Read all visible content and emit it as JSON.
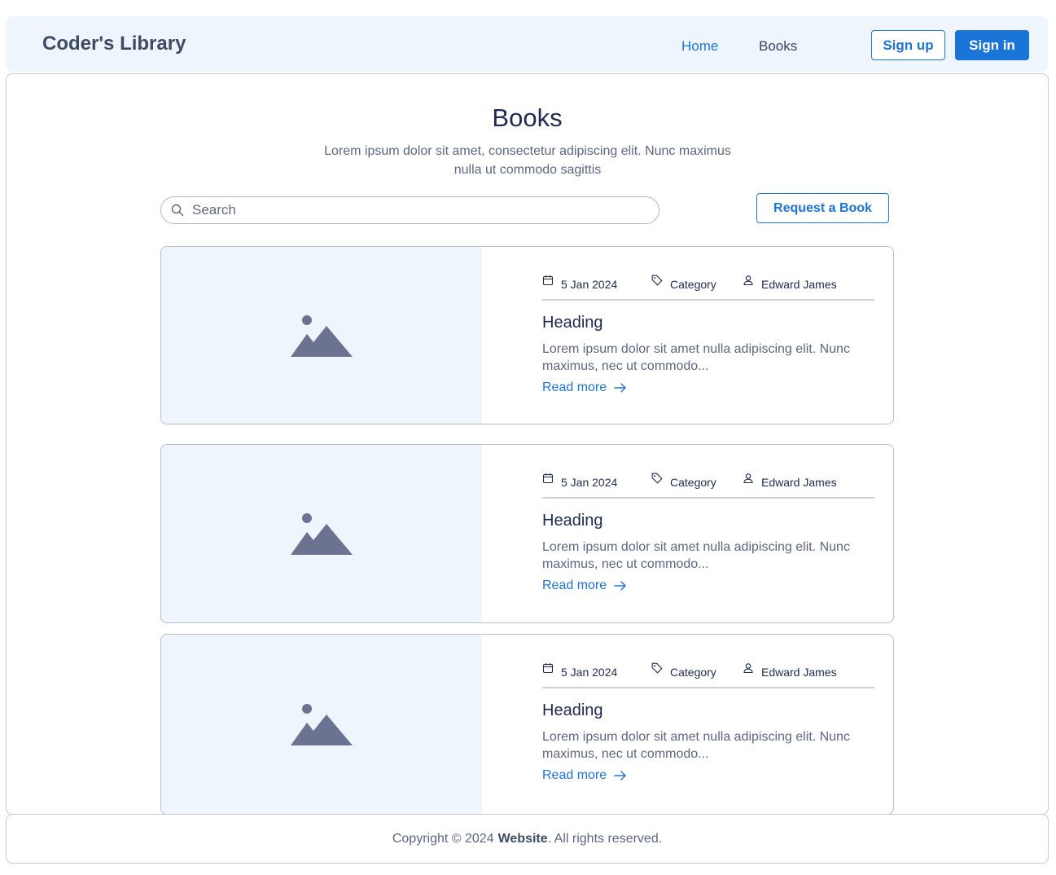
{
  "header": {
    "brand": "Coder's Library",
    "nav": [
      {
        "label": "Home",
        "active": true
      },
      {
        "label": "Books",
        "active": false
      }
    ],
    "signup_label": "Sign up",
    "signin_label": "Sign in"
  },
  "main": {
    "title": "Books",
    "subtitle": "Lorem ipsum dolor sit amet, consectetur adipiscing elit. Nunc maximus nulla ut commodo sagittis",
    "search_placeholder": "Search",
    "request_label": "Request a Book",
    "cards": [
      {
        "date": "5 Jan 2024",
        "category": "Category",
        "author": "Edward James",
        "heading": "Heading",
        "text": "Lorem ipsum dolor sit amet nulla adipiscing elit. Nunc maximus, nec ut commodo...",
        "link": "Read more"
      },
      {
        "date": "5 Jan 2024",
        "category": "Category",
        "author": "Edward James",
        "heading": "Heading",
        "text": "Lorem ipsum dolor sit amet nulla adipiscing elit. Nunc maximus, nec ut commodo...",
        "link": "Read more"
      },
      {
        "date": "5 Jan 2024",
        "category": "Category",
        "author": "Edward James",
        "heading": "Heading",
        "text": "Lorem ipsum dolor sit amet nulla adipiscing elit. Nunc maximus, nec ut commodo...",
        "link": "Read more"
      }
    ]
  },
  "footer": {
    "prefix": "Copyright © 2024",
    "site": "Website",
    "suffix": ". All rights reserved."
  },
  "colors": {
    "accent": "#1b74d8",
    "nav_bg": "#eff5fd",
    "heading": "#1e2a55",
    "muted": "#5c6683"
  },
  "icons": [
    "search-icon",
    "calendar-icon",
    "tag-icon",
    "user-icon",
    "image-placeholder-icon",
    "arrow-right-icon"
  ]
}
